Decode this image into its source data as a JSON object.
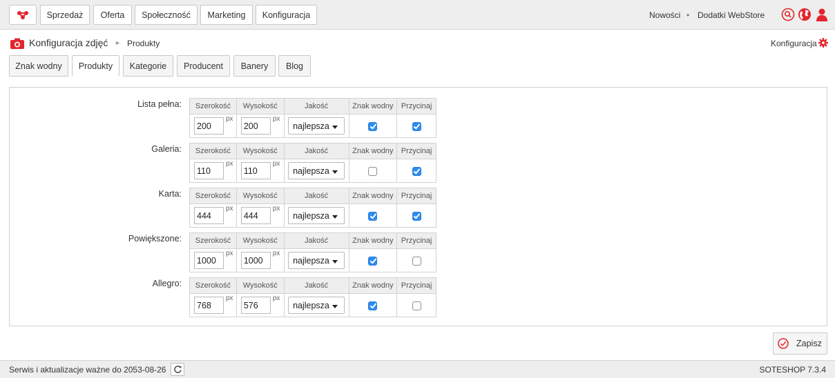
{
  "top_nav": {
    "items": [
      {
        "label": "Sprzedaż"
      },
      {
        "label": "Oferta"
      },
      {
        "label": "Społeczność"
      },
      {
        "label": "Marketing"
      },
      {
        "label": "Konfiguracja"
      }
    ],
    "right_links": [
      "Nowości",
      "Dodatki WebStore"
    ],
    "separator": "•",
    "icons": [
      "search-icon",
      "globe-icon",
      "user-icon"
    ]
  },
  "breadcrumb": {
    "title": "Konfiguracja zdjęć",
    "separator": "►",
    "current": "Produkty",
    "config_link": "Konfiguracja"
  },
  "tabs": [
    {
      "label": "Znak wodny",
      "active": false
    },
    {
      "label": "Produkty",
      "active": true
    },
    {
      "label": "Kategorie",
      "active": false
    },
    {
      "label": "Producent",
      "active": false
    },
    {
      "label": "Banery",
      "active": false
    },
    {
      "label": "Blog",
      "active": false
    }
  ],
  "columns": [
    "Szerokość",
    "Wysokość",
    "Jakość",
    "Znak wodny",
    "Przycinaj"
  ],
  "unit": "px",
  "rows": [
    {
      "label": "Lista pełna:",
      "width": "200",
      "height": "200",
      "quality": "najlepsza",
      "watermark": true,
      "crop": true
    },
    {
      "label": "Galeria:",
      "width": "110",
      "height": "110",
      "quality": "najlepsza",
      "watermark": false,
      "crop": true
    },
    {
      "label": "Karta:",
      "width": "444",
      "height": "444",
      "quality": "najlepsza",
      "watermark": true,
      "crop": true
    },
    {
      "label": "Powiększone:",
      "width": "1000",
      "height": "1000",
      "quality": "najlepsza",
      "watermark": true,
      "crop": false
    },
    {
      "label": "Allegro:",
      "width": "768",
      "height": "576",
      "quality": "najlepsza",
      "watermark": true,
      "crop": false
    }
  ],
  "save_button": {
    "label": "Zapisz"
  },
  "footer": {
    "service_text": "Serwis i aktualizacje ważne do 2053-08-26",
    "version": "SOTESHOP 7.3.4"
  },
  "colors": {
    "accent_red": "#e3262d",
    "checkbox_blue": "#2d8cf0"
  }
}
